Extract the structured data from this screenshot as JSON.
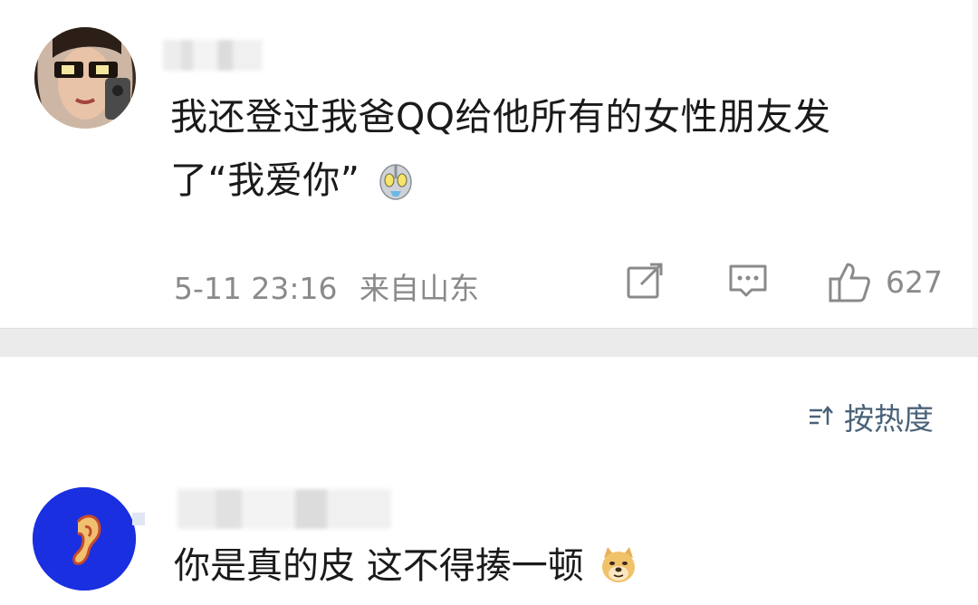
{
  "post": {
    "text_line1": "我还登过我爸QQ给他所有的女性朋友发",
    "text_line2": "了“我爱你”",
    "emoji": "ultraman-face-emoji",
    "timestamp": "5-11 23:16",
    "location": "来自山东",
    "like_count": "627"
  },
  "sort": {
    "label": "按热度",
    "icon": "sort-icon"
  },
  "comment": {
    "text": "你是真的皮 这不得揍一顿",
    "emoji": "doge-emoji"
  },
  "colors": {
    "text": "#1a1a1a",
    "meta": "#8a8a8a",
    "sort": "#4a6278",
    "avatar2_bg": "#1a2fe0",
    "divider": "#ebebeb"
  }
}
